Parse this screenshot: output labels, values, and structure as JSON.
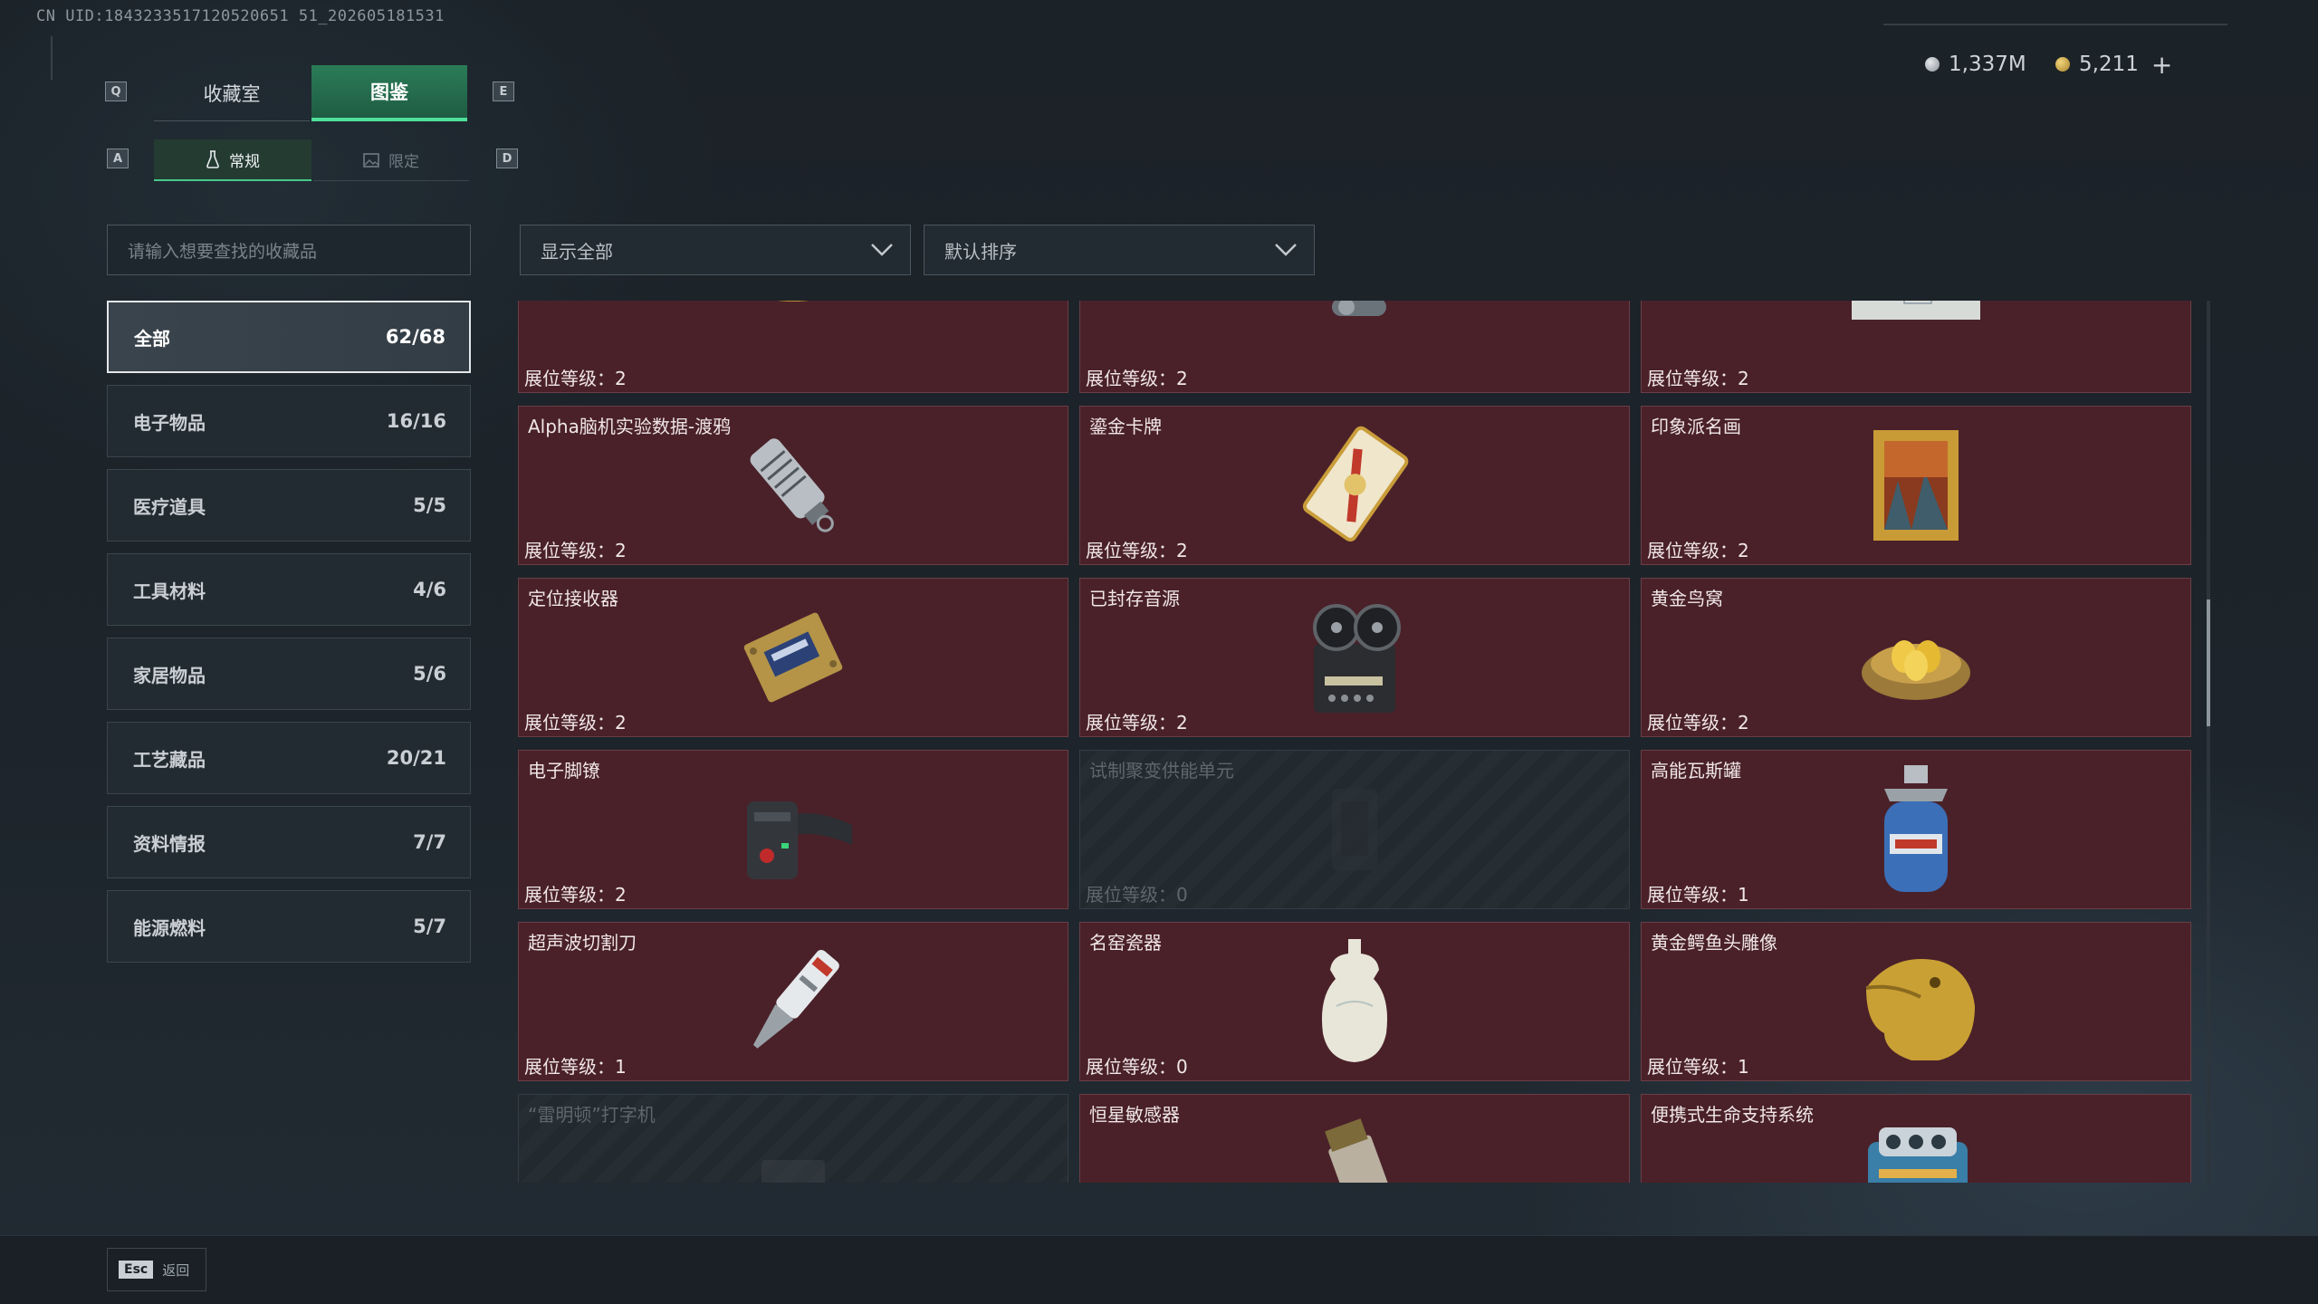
{
  "uid": "CN UID:1843233517120520651 51_202605181531",
  "keys": {
    "prev_tab": "Q",
    "next_tab": "E",
    "prev_sub": "A",
    "next_sub": "D"
  },
  "tabs": [
    {
      "label": "收藏室",
      "active": false
    },
    {
      "label": "图鉴",
      "active": true
    }
  ],
  "subtabs": [
    {
      "label": "常规",
      "icon": "flask-icon",
      "active": true
    },
    {
      "label": "限定",
      "icon": "image-icon",
      "active": false
    }
  ],
  "currency": {
    "silver": {
      "value": "1,337M",
      "icon": "silver-coin-icon"
    },
    "gold": {
      "value": "5,211",
      "icon": "gold-coin-icon",
      "add": "+"
    }
  },
  "search": {
    "placeholder": "请输入想要查找的收藏品"
  },
  "filters": {
    "show": {
      "value": "显示全部"
    },
    "sort": {
      "value": "默认排序"
    }
  },
  "categories": [
    {
      "label": "全部",
      "count": "62/68",
      "active": true
    },
    {
      "label": "电子物品",
      "count": "16/16",
      "active": false
    },
    {
      "label": "医疗道具",
      "count": "5/5",
      "active": false
    },
    {
      "label": "工具材料",
      "count": "4/6",
      "active": false
    },
    {
      "label": "家居物品",
      "count": "5/6",
      "active": false
    },
    {
      "label": "工艺藏品",
      "count": "20/21",
      "active": false
    },
    {
      "label": "资料情报",
      "count": "7/7",
      "active": false
    },
    {
      "label": "能源燃料",
      "count": "5/7",
      "active": false
    }
  ],
  "items": [
    {
      "name": "",
      "level": "展位等级：2",
      "locked": false,
      "icon": "caviar-tin-icon"
    },
    {
      "name": "",
      "level": "展位等级：2",
      "locked": false,
      "icon": "mechanical-device-icon"
    },
    {
      "name": "",
      "level": "展位等级：2",
      "locked": false,
      "icon": "blueprint-map-icon"
    },
    {
      "name": "Alpha脑机实验数据-渡鸦",
      "level": "展位等级：2",
      "locked": false,
      "icon": "data-drive-icon"
    },
    {
      "name": "鎏金卡牌",
      "level": "展位等级：2",
      "locked": false,
      "icon": "gilded-card-icon"
    },
    {
      "name": "印象派名画",
      "level": "展位等级：2",
      "locked": false,
      "icon": "painting-icon"
    },
    {
      "name": "定位接收器",
      "level": "展位等级：2",
      "locked": false,
      "icon": "receiver-icon"
    },
    {
      "name": "已封存音源",
      "level": "展位等级：2",
      "locked": false,
      "icon": "tape-recorder-icon"
    },
    {
      "name": "黄金鸟窝",
      "level": "展位等级：2",
      "locked": false,
      "icon": "golden-nest-icon"
    },
    {
      "name": "电子脚镣",
      "level": "展位等级：2",
      "locked": false,
      "icon": "ankle-monitor-icon"
    },
    {
      "name": "试制聚变供能单元",
      "level": "展位等级：0",
      "locked": true,
      "icon": "fusion-cell-icon"
    },
    {
      "name": "高能瓦斯罐",
      "level": "展位等级：1",
      "locked": false,
      "icon": "gas-canister-icon"
    },
    {
      "name": "超声波切割刀",
      "level": "展位等级：1",
      "locked": false,
      "icon": "ultrasonic-cutter-icon"
    },
    {
      "name": "名窑瓷器",
      "level": "展位等级：0",
      "locked": false,
      "icon": "porcelain-vase-icon"
    },
    {
      "name": "黄金鳄鱼头雕像",
      "level": "展位等级：1",
      "locked": false,
      "icon": "gold-crocodile-icon"
    },
    {
      "name": "“雷明顿”打字机",
      "level": "",
      "locked": true,
      "icon": "typewriter-icon"
    },
    {
      "name": "恒星敏感器",
      "level": "",
      "locked": false,
      "icon": "star-sensor-icon"
    },
    {
      "name": "便携式生命支持系统",
      "level": "",
      "locked": false,
      "icon": "life-support-icon"
    }
  ],
  "footer": {
    "key": "Esc",
    "label": "返回"
  }
}
